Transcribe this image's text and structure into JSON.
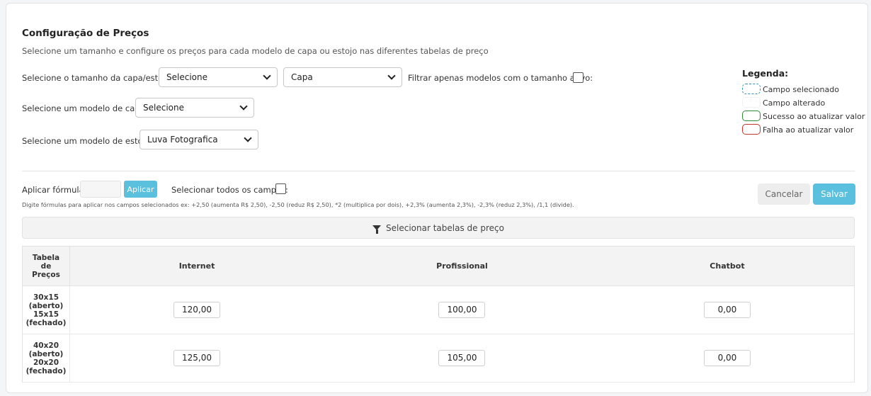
{
  "header": {
    "title": "Configuração de Preços",
    "subtitle": "Selecione um tamanho e configure os preços para cada modelo de capa ou estojo nas diferentes tabelas de preço"
  },
  "filters": {
    "size_label": "Selecione o tamanho da capa/estojo:",
    "size_value": "Selecione",
    "type_value": "Capa",
    "only_active_label": "Filtrar apenas modelos com o tamanho ativo:",
    "cover_model_label": "Selecione um modelo de capa:",
    "cover_model_value": "Selecione",
    "case_model_label": "Selecione um modelo de estojo:",
    "case_model_value": "Luva Fotografica"
  },
  "legend": {
    "title": "Legenda:",
    "items": [
      {
        "label": "Campo selecionado",
        "color": "#2f8fb0",
        "style": "dashed"
      },
      {
        "label": "Campo alterado",
        "color": "#e4e4e4",
        "style": "dotted"
      },
      {
        "label": "Sucesso ao atualizar valor",
        "color": "#2e8b3a",
        "style": "solid"
      },
      {
        "label": "Falha ao atualizar valor",
        "color": "#c0392b",
        "style": "solid"
      }
    ]
  },
  "formula": {
    "label": "Aplicar fórmula:",
    "value": "",
    "apply_label": "Aplicar",
    "select_all_label": "Selecionar todos os campos:",
    "hint": "Digite fórmulas para aplicar nos campos selecionados ex: +2,50 (aumenta R$ 2,50), -2,50 (reduz R$ 2,50), *2 (multiplica por dois), +2,3% (aumenta 2,3%), -2,3% (reduz 2,3%), /1,1 (divide)."
  },
  "actions": {
    "cancel_label": "Cancelar",
    "save_label": "Salvar"
  },
  "filter_bar": {
    "label": "Selecionar tabelas de preço"
  },
  "table": {
    "first_header": [
      "Tabela",
      "de",
      "Preços"
    ],
    "columns": [
      "Internet",
      "Profissional",
      "Chatbot"
    ],
    "rows": [
      {
        "size": [
          "30x15",
          "(aberto)",
          "15x15",
          "(fechado)"
        ],
        "values": [
          "120,00",
          "100,00",
          "0,00"
        ]
      },
      {
        "size": [
          "40x20",
          "(aberto)",
          "20x20",
          "(fechado)"
        ],
        "values": [
          "125,00",
          "105,00",
          "0,00"
        ]
      }
    ]
  },
  "colors": {
    "accent": "#5bc0de",
    "cancel_bg": "#ededed"
  }
}
